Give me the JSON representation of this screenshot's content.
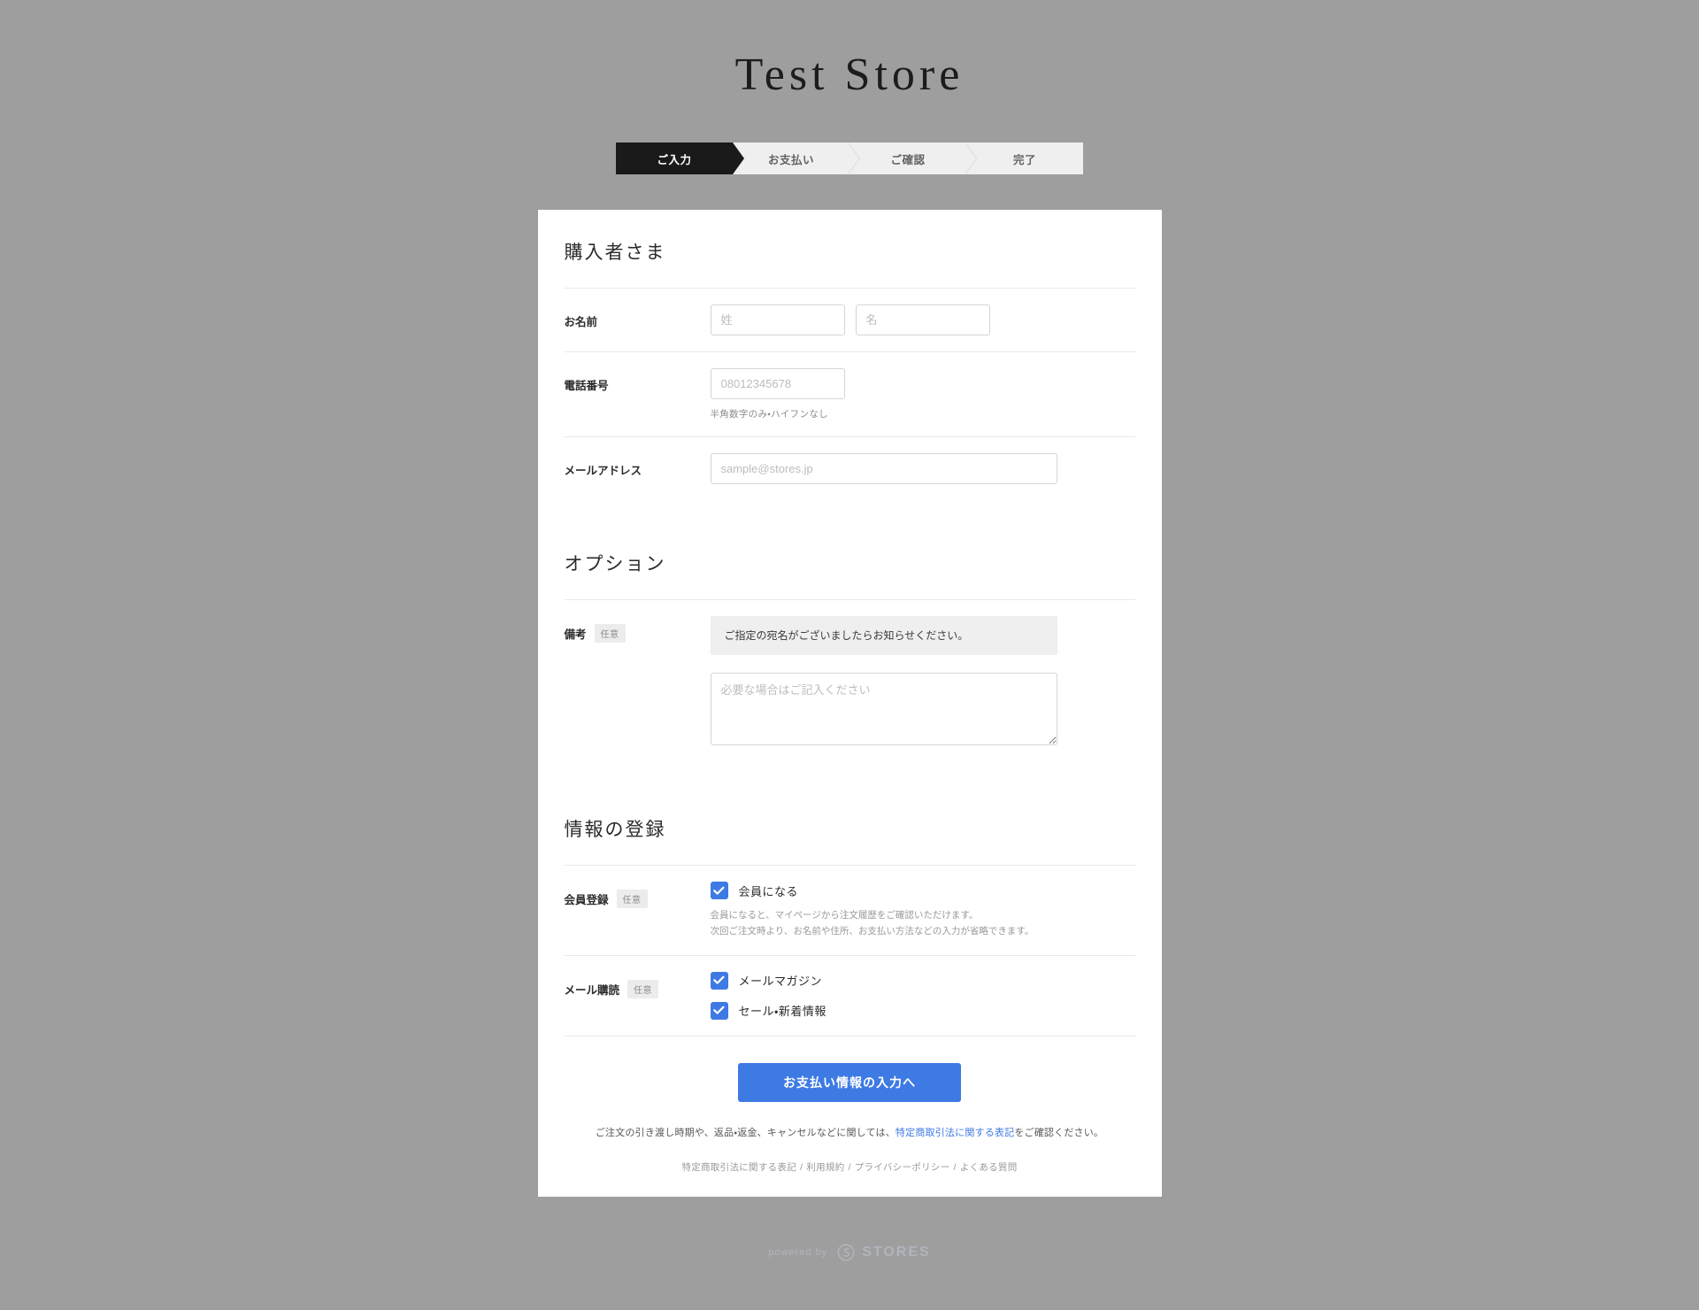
{
  "store": {
    "title": "Test Store"
  },
  "steps": [
    {
      "label": "ご入力",
      "active": true
    },
    {
      "label": "お支払い",
      "active": false
    },
    {
      "label": "ご確認",
      "active": false
    },
    {
      "label": "完了",
      "active": false
    }
  ],
  "buyer_section": {
    "title": "購入者さま",
    "name": {
      "label": "お名前",
      "last_placeholder": "姓",
      "last_value": "",
      "first_placeholder": "名",
      "first_value": ""
    },
    "phone": {
      "label": "電話番号",
      "placeholder": "08012345678",
      "value": "",
      "hint": "半角数字のみ・ハイフンなし"
    },
    "email": {
      "label": "メールアドレス",
      "placeholder": "sample@stores.jp",
      "value": ""
    }
  },
  "option_section": {
    "title": "オプション",
    "remarks": {
      "label": "備考",
      "badge": "任意",
      "notice": "ご指定の宛名がございましたらお知らせください。",
      "placeholder": "必要な場合はご記入ください",
      "value": ""
    }
  },
  "registration_section": {
    "title": "情報の登録",
    "membership": {
      "label": "会員登録",
      "badge": "任意",
      "checkbox_label": "会員になる",
      "checked": true,
      "help_line1": "会員になると、マイページから注文履歴をご確認いただけます。",
      "help_line2": "次回ご注文時より、お名前や住所、お支払い方法などの入力が省略できます。"
    },
    "mail_subscription": {
      "label": "メール購読",
      "badge": "任意",
      "options": [
        {
          "label": "メールマガジン",
          "checked": true
        },
        {
          "label": "セール・新着情報",
          "checked": true
        }
      ]
    }
  },
  "submit": {
    "button_label": "お支払い情報の入力へ",
    "legal_prefix": "ご注文の引き渡し時期や、返品・返金、キャンセルなどに関しては、",
    "legal_link": "特定商取引法に関する表記",
    "legal_suffix": "をご確認ください。"
  },
  "footer": {
    "links": [
      "特定商取引法に関する表記",
      "利用規約",
      "プライバシーポリシー",
      "よくある質問"
    ],
    "separator": "/",
    "powered_by_text": "powered by",
    "powered_by_brand": "STORES"
  },
  "colors": {
    "accent": "#3e7ae4",
    "page_background": "#9e9e9e",
    "card_background": "#ffffff",
    "step_active": "#1a1a1a",
    "step_inactive": "#efefef"
  }
}
